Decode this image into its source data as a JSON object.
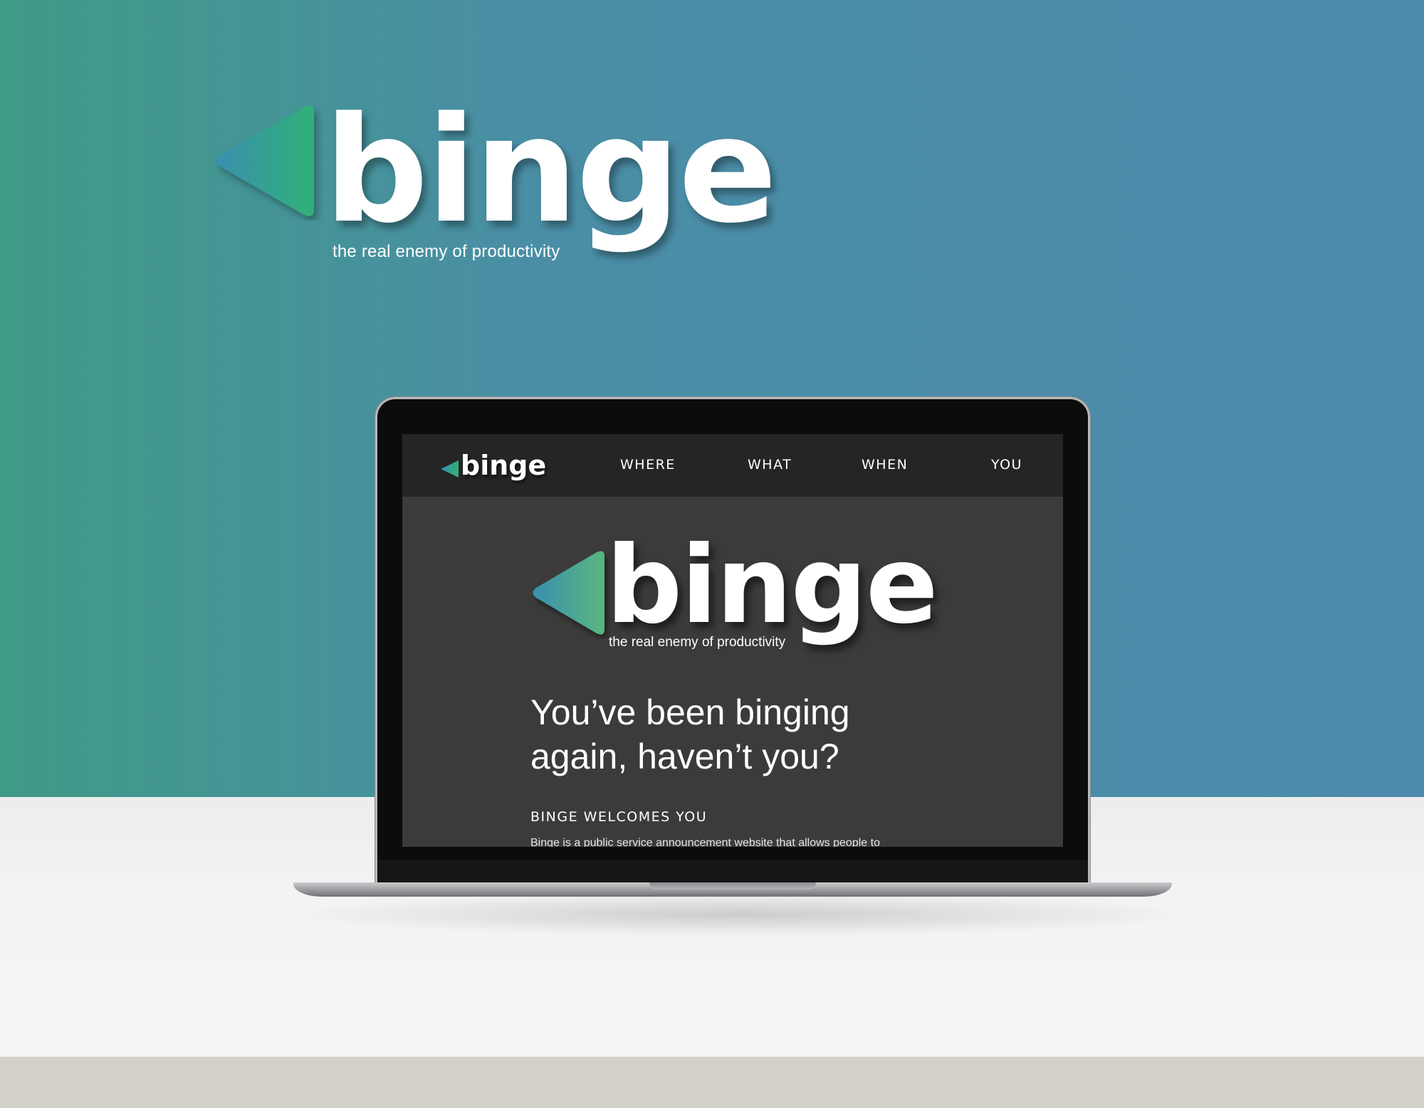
{
  "brand": {
    "name": "binge",
    "tagline": "the real enemy of productivity"
  },
  "nav": {
    "items": [
      {
        "label": "WHERE"
      },
      {
        "label": "WHAT"
      },
      {
        "label": "WHEN"
      },
      {
        "label": "YOU"
      }
    ]
  },
  "hero": {
    "headline_line1": "You’ve been binging",
    "headline_line2": "again, haven’t you?",
    "subhead": "BINGE WELCOMES YOU",
    "body": "Binge is a public service announcement website that allows people to"
  },
  "colors": {
    "wall": "#4d8aab",
    "accent_green": "#2fb176",
    "accent_blue": "#3a8fb0",
    "screen_bg": "#3b3b3b",
    "nav_bg": "#252525"
  },
  "icons": {
    "logo_mark": "play-triangle-left-icon"
  }
}
